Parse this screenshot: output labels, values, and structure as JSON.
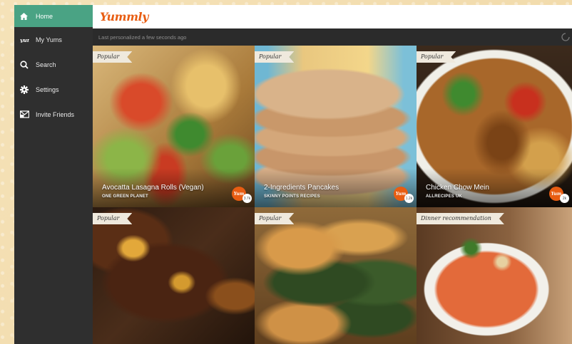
{
  "app": {
    "logo": "Yummly"
  },
  "sidebar": {
    "items": [
      {
        "label": "Home",
        "icon": "home-icon",
        "active": true
      },
      {
        "label": "My Yums",
        "icon": "yum-icon"
      },
      {
        "label": "Search",
        "icon": "search-icon"
      },
      {
        "label": "Settings",
        "icon": "gear-icon"
      },
      {
        "label": "Invite Friends",
        "icon": "invite-icon"
      }
    ]
  },
  "status": {
    "text": "Last personalized a few seconds ago"
  },
  "colors": {
    "accent": "#4aa384",
    "brand": "#e85d12",
    "sidebar": "#2f2f2f"
  },
  "tiles": [
    {
      "ribbon": "Popular",
      "title": "Avocatta Lasagna Rolls (Vegan)",
      "source": "ONE GREEN PLANET",
      "yum": "Yum",
      "count": "3.7k"
    },
    {
      "ribbon": "Popular",
      "title": "2-Ingredients Pancakes",
      "source": "SKINNY POINTS RECIPES",
      "yum": "Yum",
      "count": "1.2k"
    },
    {
      "ribbon": "Popular",
      "title": "Chicken Chow Mein",
      "source": "ALLRECIPES UK",
      "yum": "Yum",
      "count": "2k"
    },
    {
      "ribbon": "Popular",
      "title": "",
      "source": ""
    },
    {
      "ribbon": "Popular",
      "title": "",
      "source": ""
    },
    {
      "ribbon": "Dinner recommendation",
      "title": "",
      "source": ""
    }
  ]
}
